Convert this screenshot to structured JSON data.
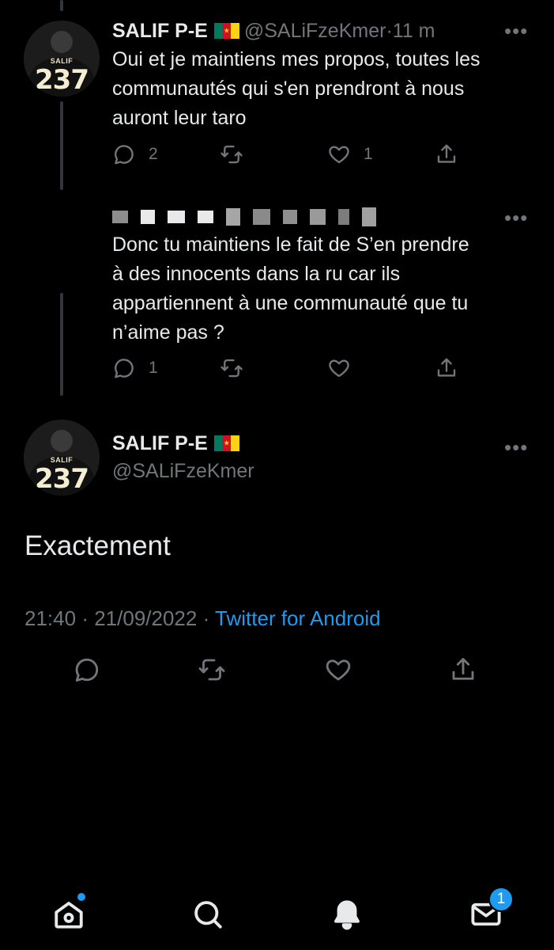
{
  "tweets": [
    {
      "name": "SALIF P-E",
      "handle": "@SALiFzeKmer",
      "sep": "·",
      "time": "11 m",
      "text_lines": [
        "Oui et je maintiens mes propos, toutes les",
        "communautés qui s'en prendront à nous",
        "auront leur taro"
      ],
      "replies": "2",
      "retweets": "",
      "likes": "1"
    },
    {
      "text_lines": [
        "Donc tu maintiens le fait de S’en prendre",
        "à des innocents dans la ru car ils",
        "appartiennent à une communauté que tu",
        "n’aime pas ?"
      ],
      "replies": "1",
      "retweets": "",
      "likes": ""
    }
  ],
  "avatar": {
    "brand": "SALIF",
    "number": "237"
  },
  "main_tweet": {
    "name": "SALIF P-E",
    "handle": "@SALiFzeKmer",
    "text": "Exactement",
    "time": "21:40",
    "sep1": "·",
    "date": "21/09/2022",
    "sep2": "·",
    "source": "Twitter for Android"
  },
  "more_label": "•••",
  "flag_star": "★",
  "nav": {
    "messages_badge": "1"
  },
  "colors": {
    "background": "#000000",
    "text": "#e7e9ea",
    "secondary": "#71767b",
    "accent": "#1d9bf0"
  },
  "icons": [
    "reply-icon",
    "retweet-icon",
    "like-icon",
    "share-icon",
    "home-icon",
    "search-icon",
    "bell-icon",
    "mail-icon"
  ]
}
